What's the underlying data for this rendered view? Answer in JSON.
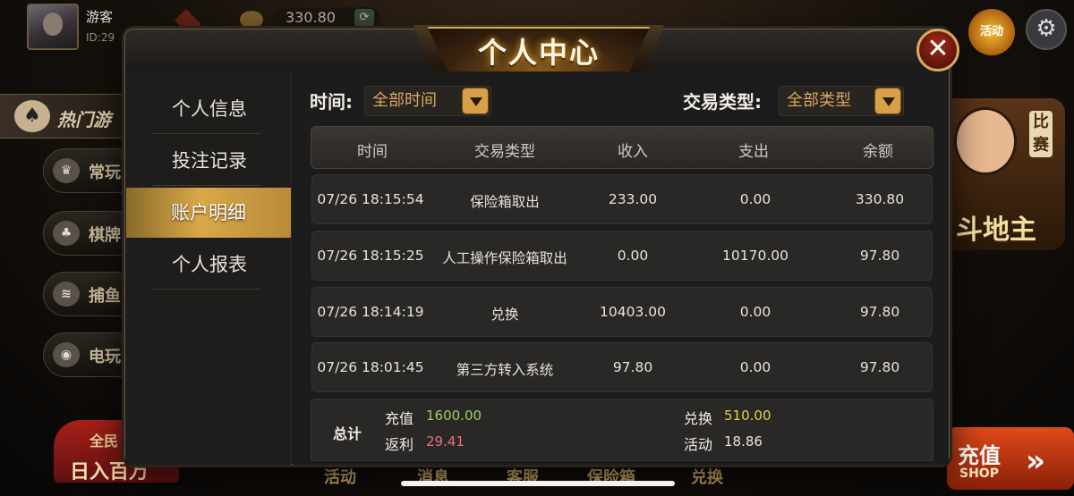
{
  "background": {
    "user_name": "游客",
    "user_id": "ID:29",
    "balance": "330.80",
    "activity_label": "活动",
    "hot_games_label": "热门游",
    "side_nav": [
      {
        "label": "常玩",
        "icon": "trophy-icon"
      },
      {
        "label": "棋牌",
        "icon": "cards-icon"
      },
      {
        "label": "捕鱼",
        "icon": "fish-icon"
      },
      {
        "label": "电玩",
        "icon": "gamepad-icon"
      }
    ],
    "promo_line1": "全民",
    "promo_line2": "日入百万",
    "right_card_badge": "比赛",
    "right_card_title": "斗地主",
    "recharge_label": "充值",
    "shop_label": "SHOP",
    "bottom_nav": [
      "活动",
      "消息",
      "客服",
      "保险箱",
      "兑换"
    ]
  },
  "modal": {
    "title": "个人中心",
    "close_symbol": "✕",
    "sidebar": [
      {
        "label": "个人信息",
        "active": false
      },
      {
        "label": "投注记录",
        "active": false
      },
      {
        "label": "账户明细",
        "active": true
      },
      {
        "label": "个人报表",
        "active": false
      }
    ],
    "filters": {
      "time_label": "时间:",
      "time_value": "全部时间",
      "type_label": "交易类型:",
      "type_value": "全部类型"
    },
    "table": {
      "columns": [
        "时间",
        "交易类型",
        "收入",
        "支出",
        "余额"
      ],
      "rows": [
        [
          "07/26 18:15:54",
          "保险箱取出",
          "233.00",
          "0.00",
          "330.80"
        ],
        [
          "07/26 18:15:25",
          "人工操作保险箱取出",
          "0.00",
          "10170.00",
          "97.80"
        ],
        [
          "07/26 18:14:19",
          "兑换",
          "10403.00",
          "0.00",
          "97.80"
        ],
        [
          "07/26 18:01:45",
          "第三方转入系统",
          "97.80",
          "0.00",
          "97.80"
        ]
      ]
    },
    "summary": {
      "total_label": "总计",
      "recharge_label": "充值",
      "recharge_value": "1600.00",
      "rebate_label": "返利",
      "rebate_value": "29.41",
      "exchange_label": "兑换",
      "exchange_value": "510.00",
      "activity_label": "活动",
      "activity_value": "18.86"
    }
  },
  "colors": {
    "accent_gold": "#d8a848",
    "recharge_green": "#9ad06a",
    "rebate_red": "#e8707a",
    "exchange_yellow": "#e8d040",
    "activity_white": "#e8e4dc"
  }
}
